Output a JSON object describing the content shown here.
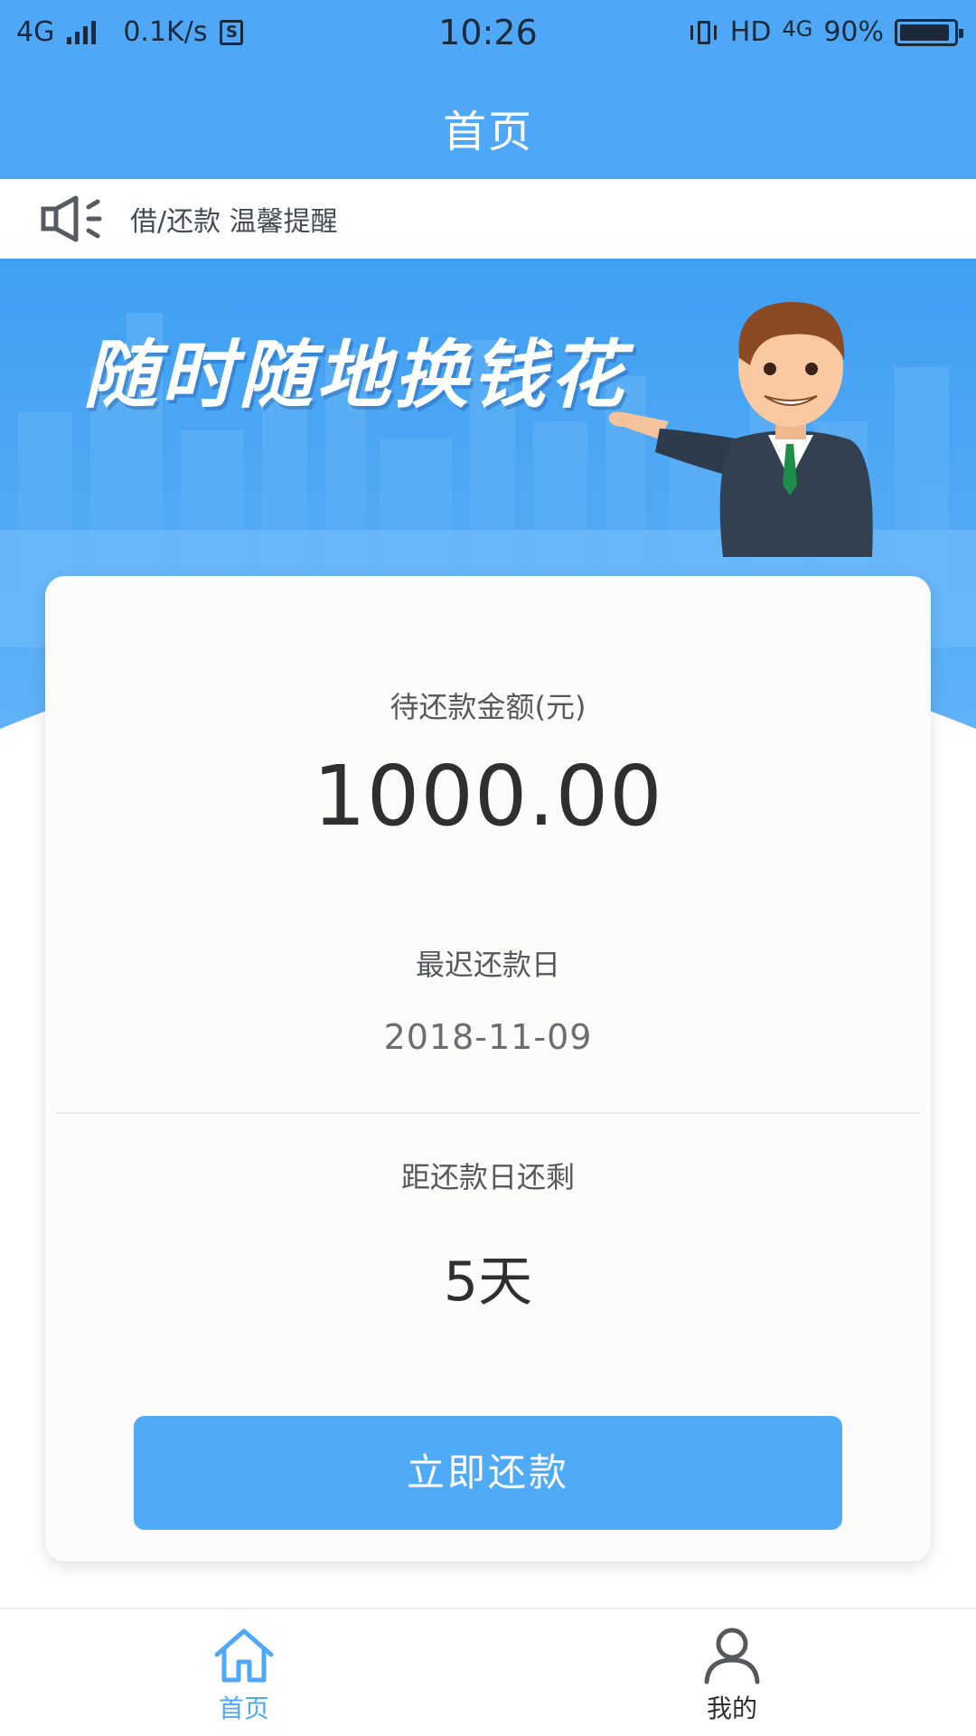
{
  "status_bar": {
    "network": "4G",
    "speed": "0.1K/s",
    "sim_badge": "S",
    "time": "10:26",
    "hd": "HD",
    "network_right": "4G",
    "battery": "90%",
    "battery_level": 0.9
  },
  "header": {
    "title": "首页"
  },
  "notice": {
    "icon": "speaker-icon",
    "text": "借/还款 温馨提醒"
  },
  "banner": {
    "slogan": "随时随地换钱花"
  },
  "card": {
    "amount_label": "待还款金额(元)",
    "amount": "1000.00",
    "due_label": "最迟还款日",
    "due_date": "2018-11-09",
    "remaining_label": "距还款日还剩",
    "remaining": "5天",
    "repay_button": "立即还款"
  },
  "tabs": [
    {
      "label": "首页",
      "icon": "home-icon",
      "active": true
    },
    {
      "label": "我的",
      "icon": "user-icon",
      "active": false
    }
  ],
  "colors": {
    "primary": "#4fa8f7",
    "button": "#4fabf7",
    "text_dark": "#2d2f31",
    "text_muted": "#55595d"
  }
}
